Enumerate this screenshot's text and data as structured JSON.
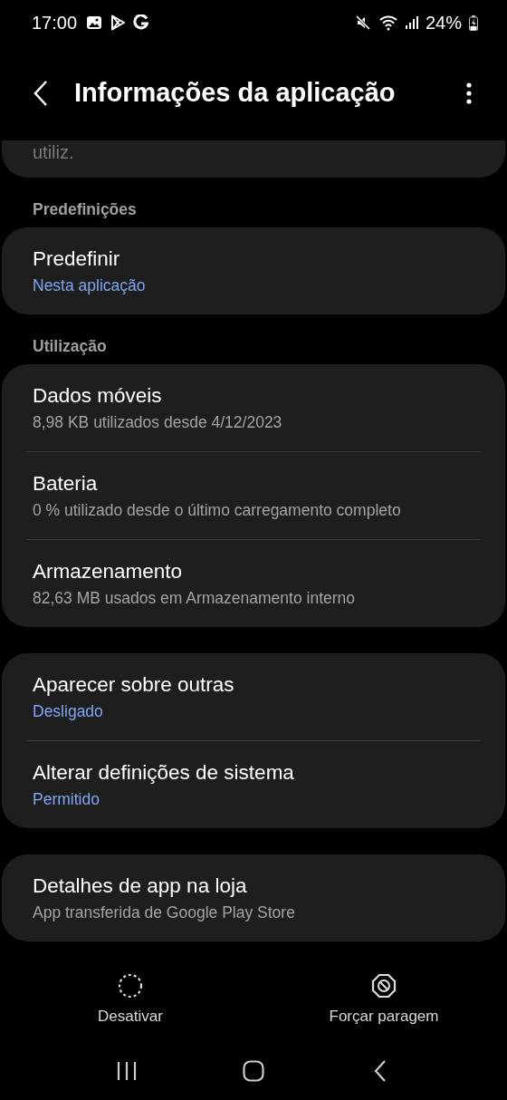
{
  "status_bar": {
    "time": "17:00",
    "battery": "24%"
  },
  "header": {
    "title": "Informações da aplicação"
  },
  "partial_text": "utiliz.",
  "sections": [
    {
      "heading": "Predefinições",
      "items": [
        {
          "title": "Predefinir",
          "subtitle": "Nesta aplicação",
          "kind": "value"
        }
      ]
    },
    {
      "heading": "Utilização",
      "items": [
        {
          "title": "Dados móveis",
          "subtitle": "8,98 KB utilizados desde 4/12/2023",
          "kind": "summary"
        },
        {
          "title": "Bateria",
          "subtitle": "0 % utilizado desde o último carregamento completo",
          "kind": "summary"
        },
        {
          "title": "Armazenamento",
          "subtitle": "82,63 MB usados em Armazenamento interno",
          "kind": "summary"
        }
      ]
    },
    {
      "items": [
        {
          "title": "Aparecer sobre outras",
          "subtitle": "Desligado",
          "kind": "value"
        },
        {
          "title": "Alterar definições de sistema",
          "subtitle": "Permitido",
          "kind": "value"
        }
      ]
    },
    {
      "items": [
        {
          "title": "Detalhes de app na loja",
          "subtitle": "App transferida de Google Play Store",
          "kind": "summary"
        }
      ]
    }
  ],
  "actions": [
    {
      "label": "Desativar",
      "kind": "disable"
    },
    {
      "label": "Forçar paragem",
      "kind": "stop"
    }
  ]
}
